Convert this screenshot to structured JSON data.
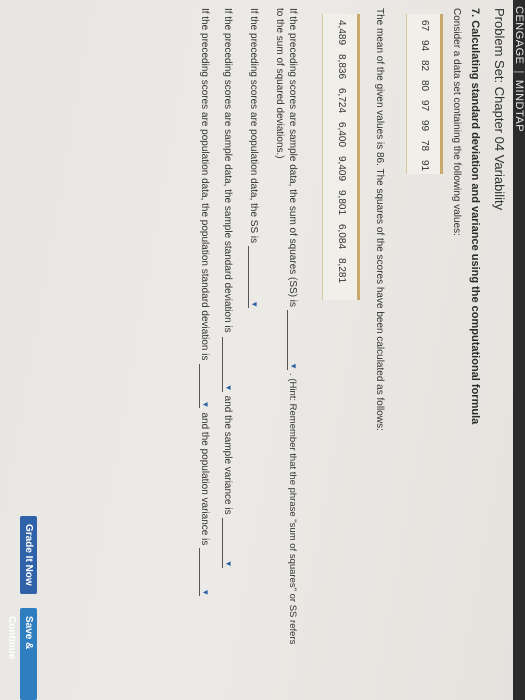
{
  "topbar": {
    "brand": "CENGAGE",
    "product": "MINDTAP"
  },
  "problem_set_title": "Problem Set: Chapter 04 Variability",
  "question_heading": "7. Calculating standard deviation and variance using the computational formula",
  "intro_text": "Consider a data set containing the following values:",
  "data_values": [
    "67",
    "94",
    "82",
    "80",
    "97",
    "99",
    "78",
    "91"
  ],
  "mean_text": "The mean of the given values is 86. The squares of the scores have been calculated as follows:",
  "squares": [
    "4,489",
    "8,836",
    "6,724",
    "6,400",
    "9,409",
    "9,801",
    "6,084",
    "8,281"
  ],
  "ss_line1_prefix": "If the preceding scores are sample data, the sum of squares (SS) is",
  "ss_line1_suffix": ". (Hint: Remember that the phrase \"sum of squares\" or SS refers",
  "ss_line2": "to the sum of squared deviations.)",
  "pop_ss_text": "If the preceding scores are population data, the SS is",
  "sample_sd_text": "If the preceding scores are sample data, the sample standard deviation is",
  "sample_var_text": "and the sample variance is",
  "pop_sd_text": "If the preceding scores are population data, the population standard deviation is",
  "pop_var_text": "and the population variance is",
  "dropdown_arrow": "▼",
  "buttons": {
    "grade": "Grade It Now",
    "save": "Save & Continue"
  },
  "colors": {
    "table_border": "#c7a96a",
    "grade_button": "#2f62a8",
    "save_button": "#2e7ec0",
    "topbar": "#2b2b2b"
  }
}
